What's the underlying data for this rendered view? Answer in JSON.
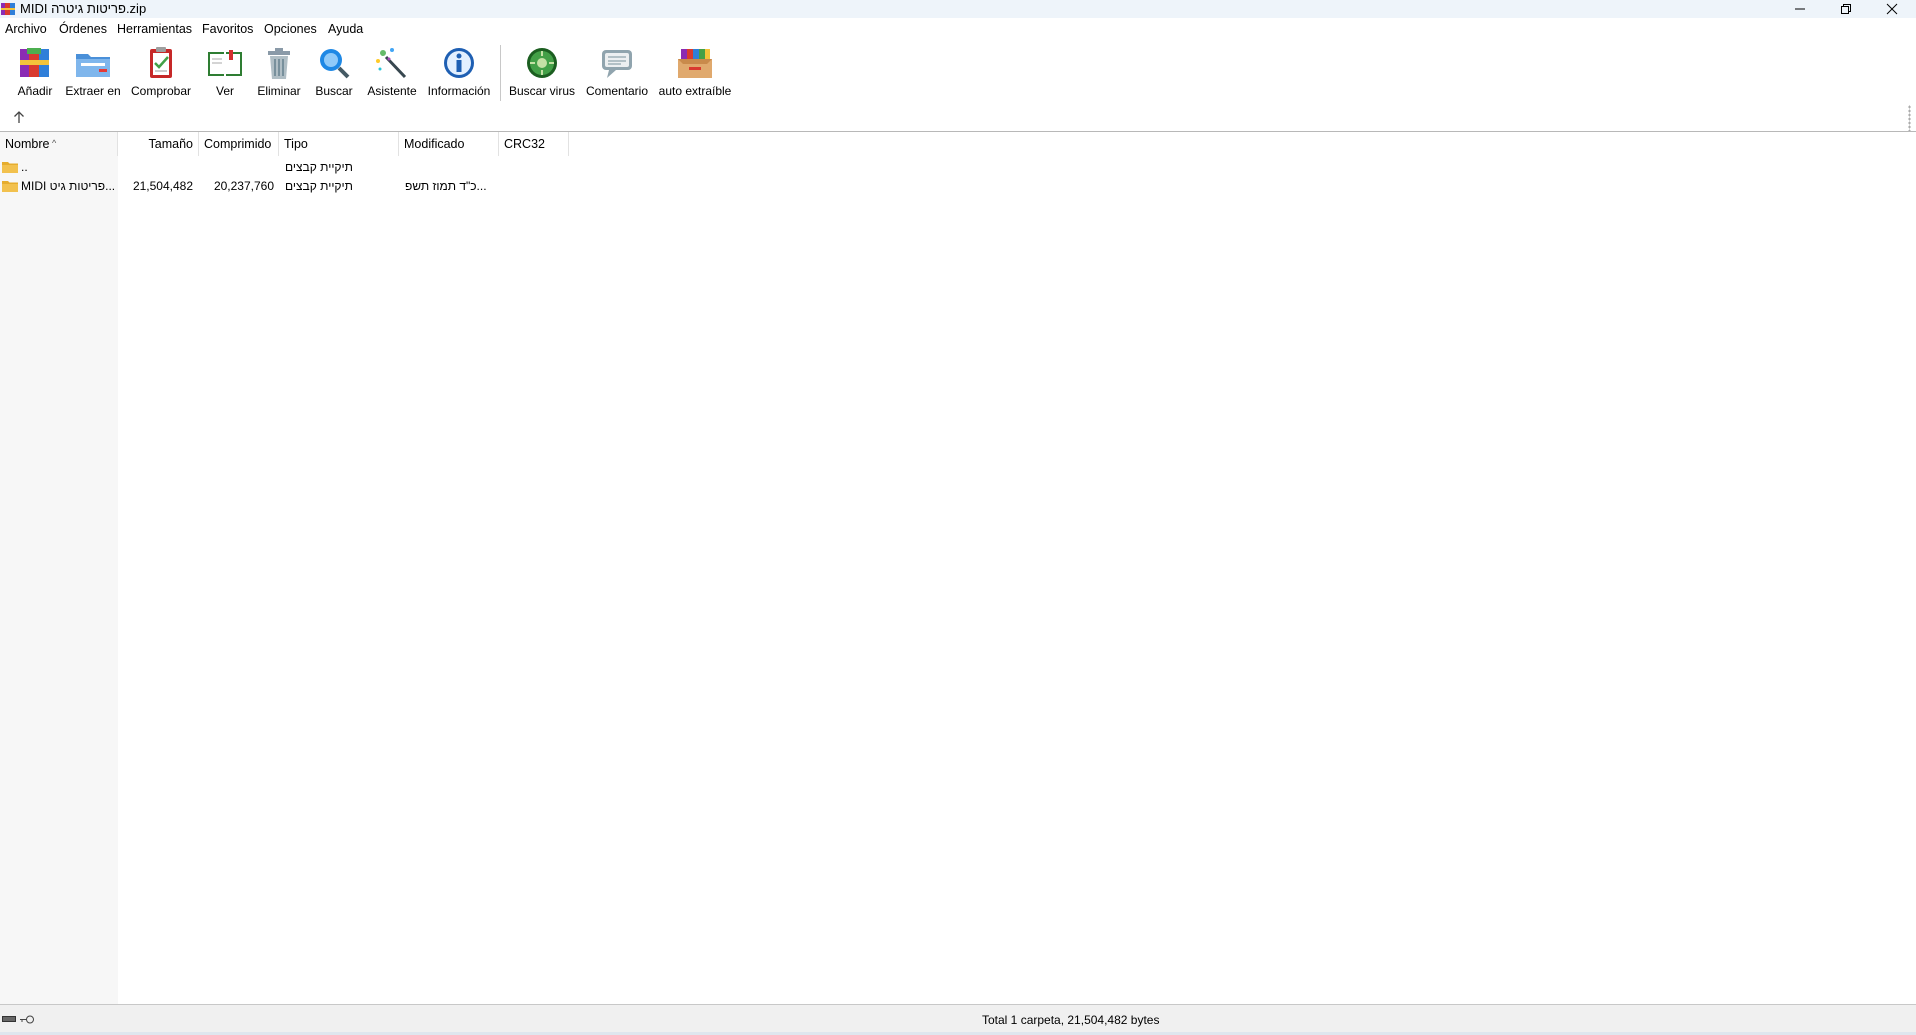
{
  "window": {
    "title": "MIDI פריטות גיטרה.zip",
    "minimize_icon": "minimize-icon",
    "restore_icon": "restore-icon",
    "close_icon": "close-icon"
  },
  "menu": [
    "Archivo",
    "Órdenes",
    "Herramientas",
    "Favoritos",
    "Opciones",
    "Ayuda"
  ],
  "toolbar": [
    {
      "label": "Añadir",
      "icon": "add-archive-icon"
    },
    {
      "label": "Extraer en",
      "icon": "extract-folder-icon"
    },
    {
      "label": "Comprobar",
      "icon": "test-clipboard-icon"
    },
    {
      "label": "Ver",
      "icon": "view-book-icon"
    },
    {
      "label": "Eliminar",
      "icon": "trash-icon"
    },
    {
      "label": "Buscar",
      "icon": "magnifier-icon"
    },
    {
      "label": "Asistente",
      "icon": "wizard-wand-icon"
    },
    {
      "label": "Información",
      "icon": "info-icon"
    },
    {
      "label": "Buscar virus",
      "icon": "virus-scan-icon"
    },
    {
      "label": "Comentario",
      "icon": "comment-icon"
    },
    {
      "label": "auto extraíble",
      "icon": "sfx-box-icon"
    }
  ],
  "columns": {
    "name": "Nombre",
    "size": "Tamaño",
    "packed": "Comprimido",
    "type": "Tipo",
    "modified": "Modificado",
    "crc": "CRC32"
  },
  "rows": [
    {
      "name": "..",
      "size": "",
      "packed": "",
      "type": "תיקיית קבצים",
      "modified": "",
      "crc": ""
    },
    {
      "name": "MIDI פריטות גיט...",
      "size": "21,504,482",
      "packed": "20,237,760",
      "type": "תיקיית קבצים",
      "modified": "כ\"ד תמוז תשפ...",
      "crc": ""
    }
  ],
  "status": {
    "text": "Total 1 carpeta, 21,504,482 bytes"
  },
  "colors": {
    "titlebar": "#eef4fa",
    "folder": "#f2c14e"
  }
}
